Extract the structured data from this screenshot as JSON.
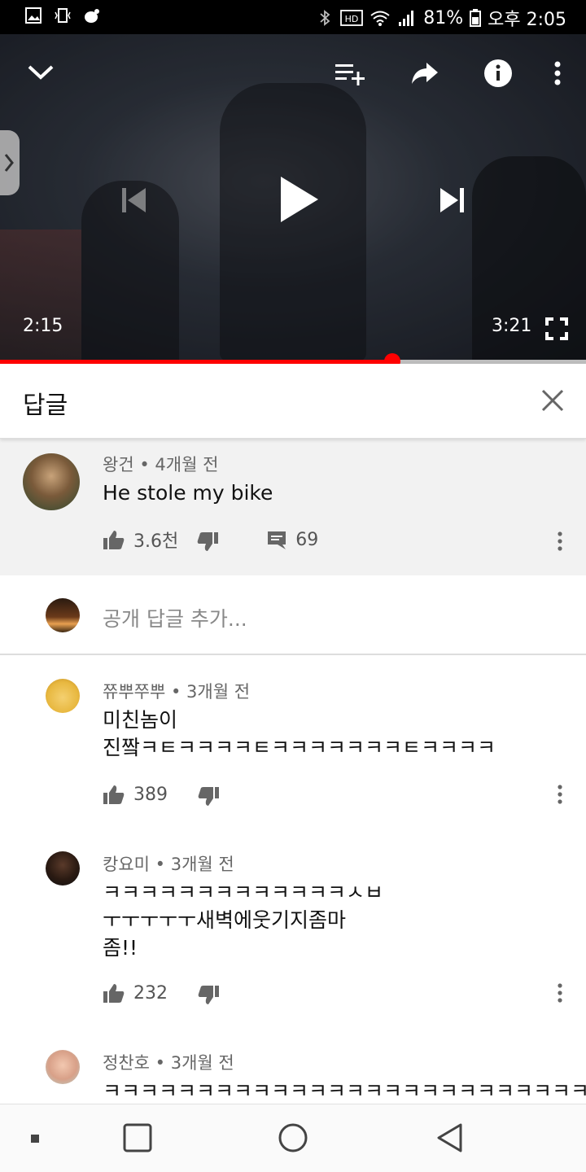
{
  "status_bar": {
    "battery": "81%",
    "time": "오후 2:05"
  },
  "player": {
    "current_time": "2:15",
    "duration": "3:21",
    "progress": 0.669
  },
  "replies_panel": {
    "title": "답글"
  },
  "parent_comment": {
    "author": "왕건",
    "age": "4개월 전",
    "text": "He stole my bike",
    "likes": "3.6천",
    "reply_count": "69"
  },
  "add_reply": {
    "placeholder": "공개 답글 추가..."
  },
  "replies": [
    {
      "author": "쮸뿌쭈뿌",
      "age": "3개월 전",
      "lines": [
        "미친놈이",
        "진짴ㅋㅌㅋㅋㅋㅋㅌㅋㅋㅋㅋㅋㅋㅋㅌㅋㅋㅋㅋ"
      ],
      "likes": "389"
    },
    {
      "author": "캉요미",
      "age": "3개월 전",
      "lines": [
        "ㅋㅋㅋㅋㅋㅋㅋㅋㅋㅋㅋㅋㅋㅅㅂ",
        "ㅜㅜㅜㅜㅜ새벽에웃기지좀마",
        "좀!!"
      ],
      "likes": "232"
    },
    {
      "author": "정찬호",
      "age": "3개월 전",
      "lines": [
        "ㅋㅋㅋㅋㅋㅋㅋㅋㅋㅋㅋㅋㅋㅋㅋㅋㅋㅋㅋㅋㅋㅋㅋㅋㅋㅋ"
      ],
      "likes": ""
    }
  ],
  "colors": {
    "progress": "#ff0000",
    "parent_bg": "#f2f2f2"
  }
}
